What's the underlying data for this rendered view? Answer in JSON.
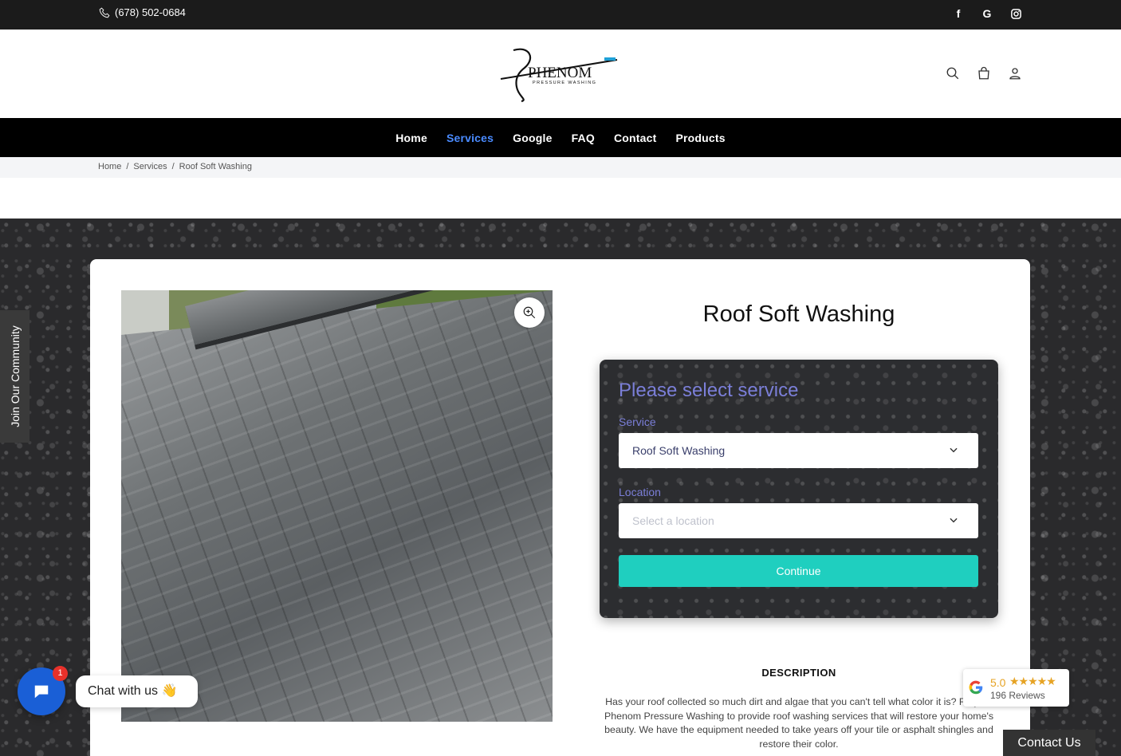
{
  "topbar": {
    "phone": "(678) 502-0684",
    "socials": [
      {
        "name": "facebook",
        "glyph": "f"
      },
      {
        "name": "google",
        "glyph": "G"
      },
      {
        "name": "instagram",
        "glyph": "◎"
      }
    ]
  },
  "brand": {
    "name": "PHENOM",
    "tagline": "PRESSURE WASHING"
  },
  "nav": {
    "items": [
      "Home",
      "Services",
      "Google",
      "FAQ",
      "Contact",
      "Products"
    ],
    "active": "Services"
  },
  "breadcrumb": {
    "items": [
      "Home",
      "Services",
      "Roof Soft Washing"
    ],
    "separator": "/"
  },
  "product": {
    "title": "Roof Soft Washing"
  },
  "booking": {
    "heading": "Please select service",
    "service_label": "Service",
    "service_value": "Roof Soft Washing",
    "location_label": "Location",
    "location_placeholder": "Select a location",
    "continue_label": "Continue"
  },
  "description": {
    "heading": "DESCRIPTION",
    "text": "Has your roof collected so much dirt and algae that you can't tell what color it is? Rely on Phenom Pressure Washing to provide roof washing services that will restore your home's beauty. We have the equipment needed to take years off your tile or asphalt shingles and restore their color."
  },
  "side_tab": {
    "label": "Join Our Community"
  },
  "chat": {
    "label": "Chat with us 👋",
    "badge": "1"
  },
  "reviews": {
    "score": "5.0",
    "stars": "★★★★★",
    "count": "196 Reviews"
  },
  "contact_tab": {
    "label": "Contact Us"
  },
  "colors": {
    "accent": "#1fcfbf",
    "nav_active": "#4a8bff",
    "form_text": "#7b7fd8",
    "chat": "#1a5fd6"
  }
}
